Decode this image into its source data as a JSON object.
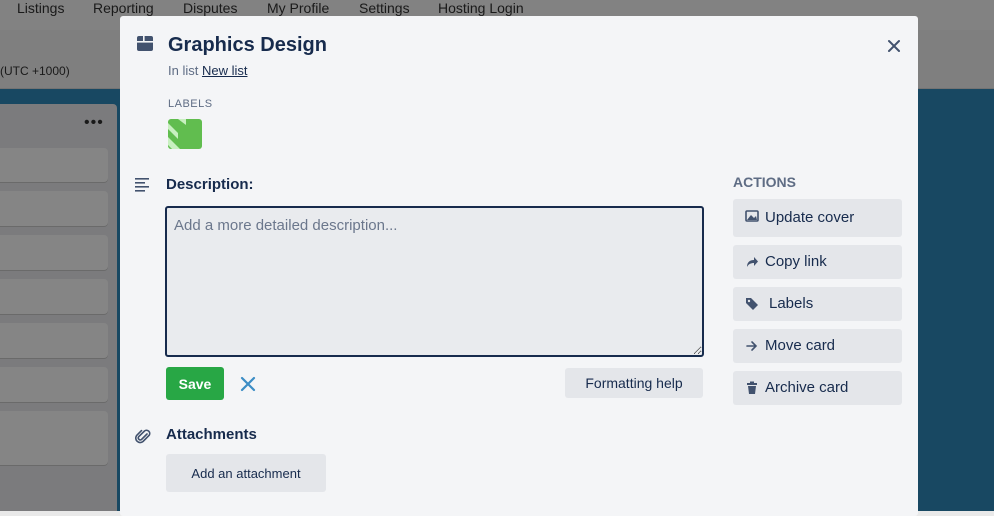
{
  "topnav": {
    "items": [
      "Listings",
      "Reporting",
      "Disputes",
      "My Profile",
      "Settings",
      "Hosting Login"
    ]
  },
  "subbar": {
    "timezone": "(UTC +1000)"
  },
  "board": {
    "list_menu_icon": "more-dots-icon"
  },
  "modal": {
    "title": "Graphics Design",
    "in_list_prefix": "In list",
    "list_name": "New list",
    "labels_heading": "Labels",
    "label_color": "#61bd4f",
    "description_heading": "Description:",
    "description_placeholder": "Add a more detailed description...",
    "description_value": "",
    "save_label": "Save",
    "formatting_help_label": "Formatting help",
    "attachments_heading": "Attachments",
    "add_attachment_label": "Add an attachment",
    "actions_heading": "ACTIONS",
    "actions": [
      {
        "label": "Update cover",
        "icon": "image-icon"
      },
      {
        "label": "Copy link",
        "icon": "share-arrow-icon"
      },
      {
        "label": "Labels",
        "icon": "tag-icon"
      },
      {
        "label": "Move card",
        "icon": "arrow-right-icon"
      },
      {
        "label": "Archive card",
        "icon": "trash-icon"
      }
    ]
  },
  "colors": {
    "save_green": "#28a745",
    "board_blue": "#2e8bbd",
    "text_dark": "#172b4d",
    "close_blue": "#3c8dc5"
  }
}
